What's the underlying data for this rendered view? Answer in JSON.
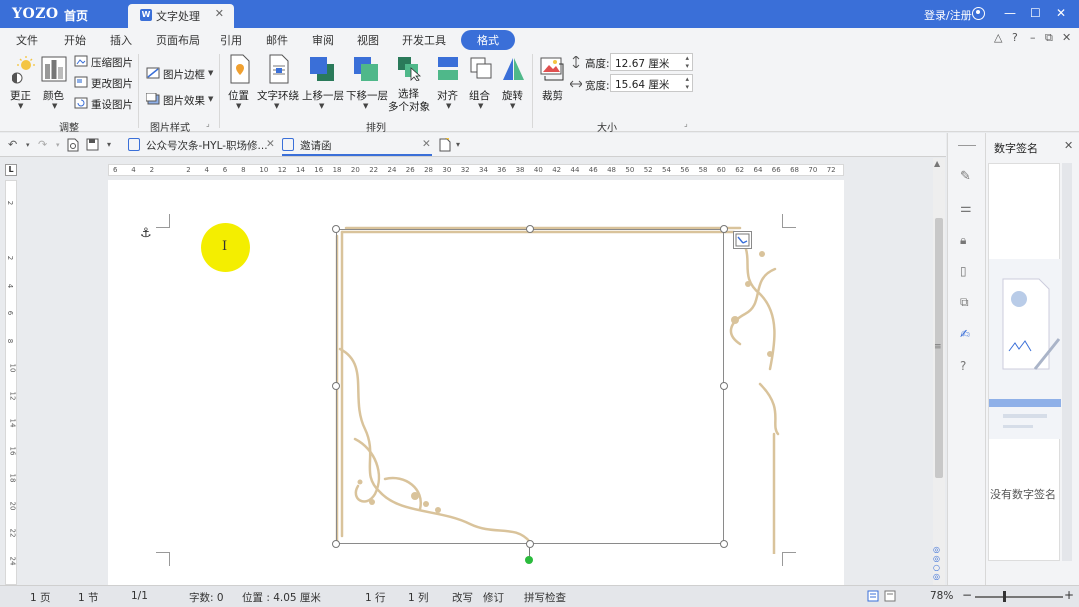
{
  "titlebar": {
    "logo": "YOZO",
    "home": "首页",
    "doc_tab_label": "文字处理",
    "doc_tab_close": "✕",
    "login": "登录/注册",
    "minimize": "—",
    "maximize": "☐",
    "close": "✕"
  },
  "menu": {
    "items": [
      "文件",
      "开始",
      "插入",
      "页面布局",
      "引用",
      "邮件",
      "审阅",
      "视图",
      "开发工具"
    ],
    "active": "格式",
    "right_icons": [
      "△",
      "?",
      "–",
      "⧉",
      "✕"
    ]
  },
  "ribbon": {
    "adjust": {
      "correct": "更正",
      "color": "颜色",
      "compress": "压缩图片",
      "change": "更改图片",
      "reset": "重设图片",
      "label": "调整"
    },
    "style": {
      "border": "图片边框",
      "effect": "图片效果",
      "label": "图片样式"
    },
    "arrange": {
      "position": "位置",
      "wrap": "文字环绕",
      "forward": "上移一层",
      "backward": "下移一层",
      "select1": "选择",
      "select2": "多个对象",
      "align": "对齐",
      "group": "组合",
      "rotate": "旋转",
      "label": "排列"
    },
    "size": {
      "crop": "裁剪",
      "height_label": "高度:",
      "height_value": "12.67 厘米",
      "width_label": "宽度:",
      "width_value": "15.64 厘米",
      "label": "大小"
    }
  },
  "tabs": {
    "file1": "公众号次条-HYL-职场修...",
    "file2": "邀请函",
    "close": "✕"
  },
  "ruler": {
    "corner": "L",
    "h_ticks": [
      "6",
      "4",
      "2",
      "",
      "2",
      "4",
      "6",
      "8",
      "10",
      "12",
      "14",
      "16",
      "18",
      "20",
      "22",
      "24",
      "26",
      "28",
      "30",
      "32",
      "34",
      "36",
      "38",
      "40",
      "42",
      "44",
      "46",
      "48",
      "50",
      "52",
      "54",
      "56",
      "58",
      "60",
      "62",
      "64",
      "66",
      "68",
      "70",
      "72"
    ],
    "v_ticks": [
      "2",
      "",
      "2",
      "4",
      "6",
      "8",
      "10",
      "12",
      "14",
      "16",
      "18",
      "20",
      "22",
      "24"
    ]
  },
  "panel": {
    "title": "数字签名",
    "close": "✕",
    "empty": "没有数字签名"
  },
  "status": {
    "page": "1 页",
    "section": "1 节",
    "pages": "1/1",
    "words": "字数: 0",
    "position": "位置 : 4.05 厘米",
    "line": "1 行",
    "col": "1 列",
    "overwrite": "改写",
    "revise": "修订",
    "spell": "拼写检查",
    "zoom": "78%",
    "minus": "−",
    "plus": "+"
  },
  "colors": {
    "accent": "#3a6fd8",
    "ornament": "#d9c39b",
    "highlight": "#f4ee00",
    "rotate_handle": "#2bbb3d"
  }
}
